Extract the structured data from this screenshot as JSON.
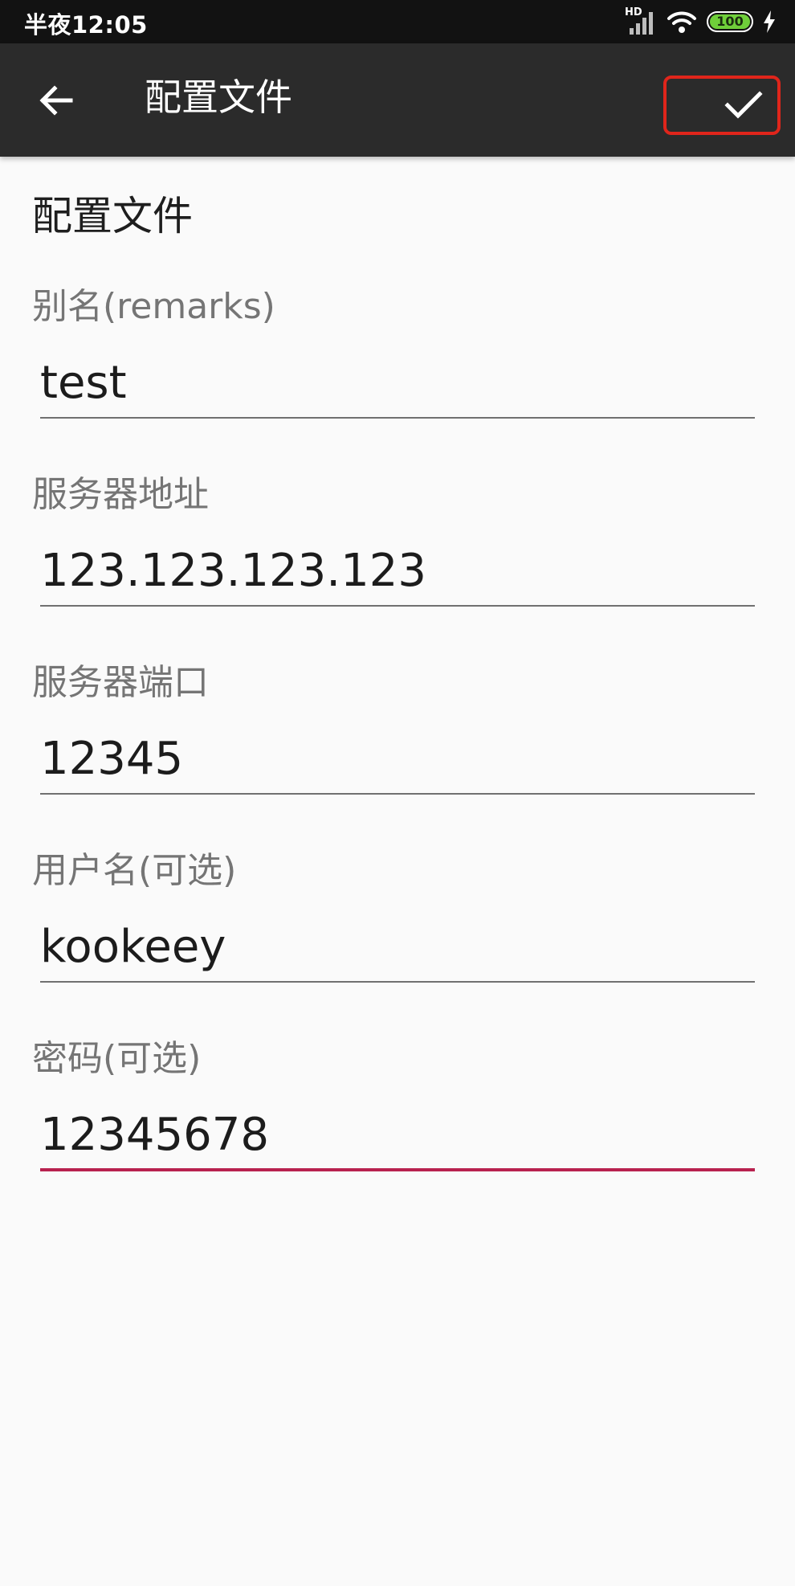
{
  "status_bar": {
    "time": "半夜12:05",
    "network_label": "HD",
    "battery_level": "100",
    "battery_color": "#6fcf3a"
  },
  "app_bar": {
    "title": "配置文件",
    "back_icon": "arrow-left-icon",
    "confirm_icon": "check-icon",
    "confirm_highlight_color": "#e0251b"
  },
  "form": {
    "section_title": "配置文件",
    "fields": [
      {
        "label": "别名(remarks)",
        "value": "test",
        "focused": false
      },
      {
        "label": "服务器地址",
        "value": "123.123.123.123",
        "focused": false
      },
      {
        "label": "服务器端口",
        "value": "12345",
        "focused": false
      },
      {
        "label": "用户名(可选)",
        "value": "kookeey",
        "focused": false
      },
      {
        "label": "密码(可选)",
        "value": "12345678",
        "focused": true
      }
    ],
    "accent_color": "#b8224f"
  }
}
